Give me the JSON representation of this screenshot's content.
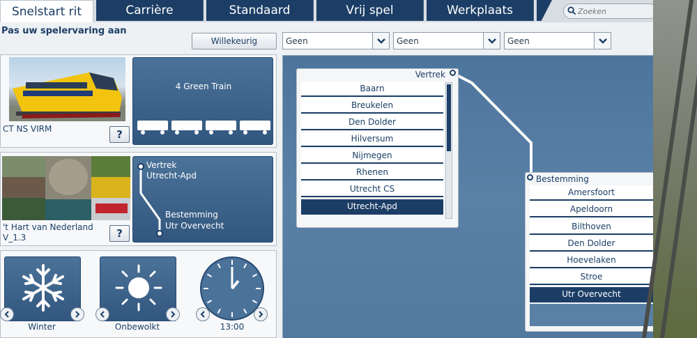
{
  "tabs": [
    {
      "label": "Snelstart rit"
    },
    {
      "label": "Carrière"
    },
    {
      "label": "Standaard"
    },
    {
      "label": "Vrij spel"
    },
    {
      "label": "Werkplaats"
    }
  ],
  "search": {
    "placeholder": "Zoeken"
  },
  "heading": "Pas uw spelervaring aan",
  "random_button": "Willekeurig",
  "filters": [
    {
      "value": "Geen"
    },
    {
      "value": "Geen"
    },
    {
      "value": "Geen"
    }
  ],
  "train": {
    "name": "CT NS VIRM",
    "consist": "4 Green Train",
    "help": "?"
  },
  "route": {
    "name_line1": "'t Hart van Nederland",
    "name_line2": "V_1.3",
    "departure_label": "Vertrek",
    "departure_value": "Utrecht-Apd",
    "destination_label": "Bestemming",
    "destination_value": "Utr Overvecht",
    "help": "?"
  },
  "conditions": {
    "season": "Winter",
    "weather": "Onbewolkt",
    "time": "13:00"
  },
  "departure_list": {
    "title": "Vertrek",
    "items": [
      "Baarn",
      "Breukelen",
      "Den Dolder",
      "Hilversum",
      "Nijmegen",
      "Rhenen",
      "Utrecht CS",
      "Utrecht-Apd"
    ],
    "selected": "Utrecht-Apd"
  },
  "destination_list": {
    "title": "Bestemming",
    "items": [
      "Amersfoort",
      "Apeldoorn",
      "Bilthoven",
      "Den Dolder",
      "Hoevelaken",
      "Stroe",
      "Utr Overvecht"
    ],
    "selected": "Utr Overvecht"
  },
  "colors": {
    "navy": "#1c3e66",
    "panel_blue": "#4b7299",
    "map_blue": "#5a80a6",
    "train_yellow": "#f2c40f"
  }
}
